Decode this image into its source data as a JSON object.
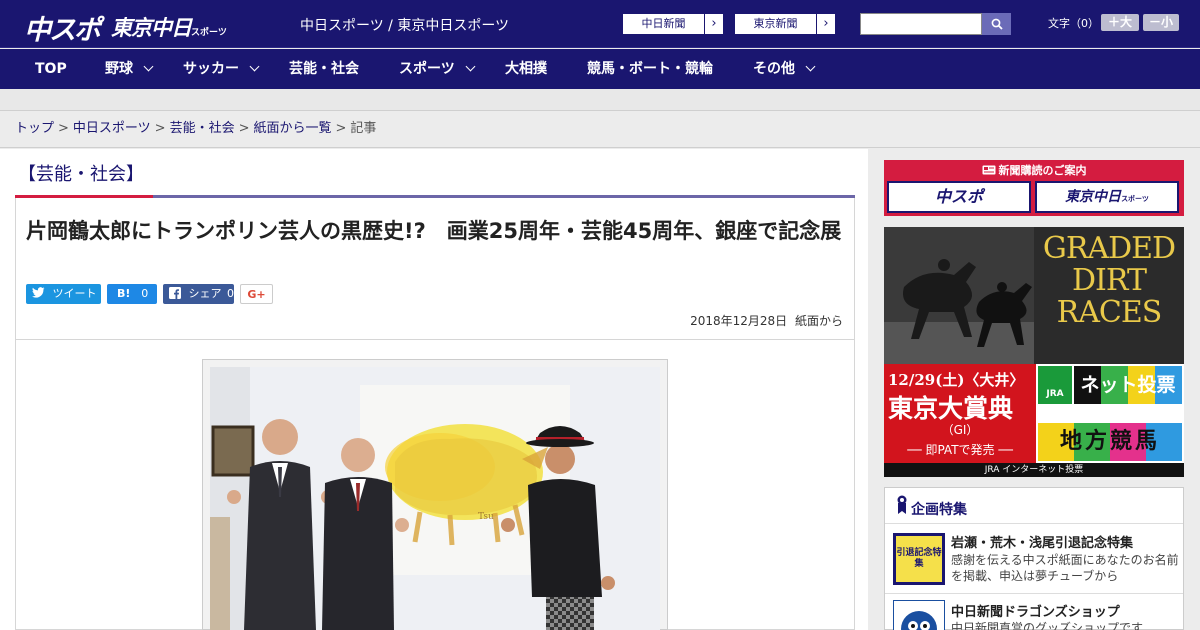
{
  "header": {
    "logo_chuspo": "中スポ",
    "logo_tokyo": "東京中日",
    "logo_tokyo_suffix": "スポーツ",
    "tagline": "中日スポーツ / 東京中日スポーツ",
    "link_chunichi": "中日新聞",
    "link_tokyo": "東京新聞",
    "search_placeholder": "",
    "font_size_label": "文字（0）",
    "font_plus": "＋大",
    "font_minus": "－小"
  },
  "nav": {
    "items": [
      {
        "label": "TOP",
        "has_dropdown": false
      },
      {
        "label": "野球",
        "has_dropdown": true
      },
      {
        "label": "サッカー",
        "has_dropdown": true
      },
      {
        "label": "芸能・社会",
        "has_dropdown": false
      },
      {
        "label": "スポーツ",
        "has_dropdown": true
      },
      {
        "label": "大相撲",
        "has_dropdown": false
      },
      {
        "label": "競馬・ボート・競輪",
        "has_dropdown": false
      },
      {
        "label": "その他",
        "has_dropdown": true
      }
    ]
  },
  "breadcrumb": {
    "items": [
      "トップ",
      "中日スポーツ",
      "芸能・社会",
      "紙面から一覧"
    ],
    "current": "記事"
  },
  "section": {
    "title": "【芸能・社会】"
  },
  "article": {
    "headline": "片岡鶴太郎にトランポリン芸人の黒歴史!?　画業25周年・芸能45周年、銀座で記念展",
    "share": {
      "tweet_label": "ツイート",
      "hatena_label": "B!",
      "hatena_count": "0",
      "facebook_label": "シェア",
      "facebook_count": "0",
      "gplus_label": "G+"
    },
    "date": "2018年12月28日",
    "source": "紙面から"
  },
  "sidebar": {
    "subscribe": {
      "title": "新聞購読のご案内",
      "btn_chuspo": "中スポ",
      "btn_tokyo": "東京中日",
      "btn_tokyo_suffix": "スポーツ"
    },
    "ad": {
      "title_line1": "GRADED",
      "title_line2": "DIRT",
      "title_line3": "RACES",
      "date": "12/29(土)〈大井〉",
      "race": "東京大賞典",
      "grade": "（GI）",
      "pat": "── 即PATで発売 ──",
      "jra": "JRA",
      "netbet": "ネット投票",
      "chiho": "地方競馬",
      "bottom": "JRA インターネット投票"
    },
    "features": {
      "title": "企画特集",
      "items": [
        {
          "thumb_text": "引退記念特集",
          "title": "岩瀬・荒木・浅尾引退記念特集",
          "desc": "感謝を伝える中スポ紙面にあなたのお名前を掲載、申込は夢チューブから"
        },
        {
          "thumb_text": "",
          "title": "中日新聞ドラゴンズショップ",
          "desc": "中日新聞直営のグッズショップです"
        }
      ]
    }
  },
  "colors": {
    "brand_navy": "#1a1670",
    "accent_red": "#d41c40",
    "section_purple": "#6c66a8",
    "twitter": "#1b95e0",
    "facebook": "#3b5998"
  }
}
